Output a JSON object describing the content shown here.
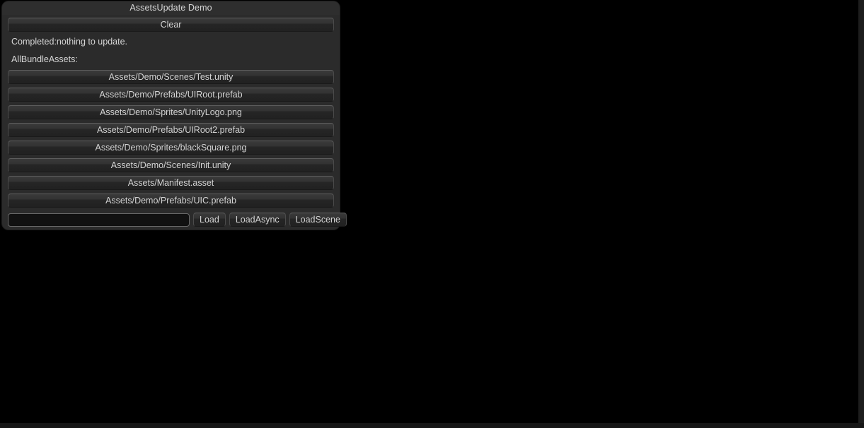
{
  "window": {
    "title": "AssetsUpdate Demo",
    "clear_label": "Clear",
    "status_message": "Completed:nothing to update.",
    "list_label": "AllBundleAssets:"
  },
  "asset_list": [
    {
      "label": "Assets/Demo/Scenes/Test.unity"
    },
    {
      "label": "Assets/Demo/Prefabs/UIRoot.prefab"
    },
    {
      "label": "Assets/Demo/Sprites/UnityLogo.png"
    },
    {
      "label": "Assets/Demo/Prefabs/UIRoot2.prefab"
    },
    {
      "label": "Assets/Demo/Sprites/blackSquare.png"
    },
    {
      "label": "Assets/Demo/Scenes/Init.unity"
    },
    {
      "label": "Assets/Manifest.asset"
    },
    {
      "label": "Assets/Demo/Prefabs/UIC.prefab"
    }
  ],
  "action_bar": {
    "input_value": "",
    "input_placeholder": "",
    "load_label": "Load",
    "load_async_label": "LoadAsync",
    "load_scene_label": "LoadScene"
  },
  "colors": {
    "background": "#000000",
    "panel": "#2b2b2b",
    "title_bar": "#2e2e2e",
    "text": "#d6d6d6",
    "button_top": "#3a3a3a",
    "button_bottom": "#212121",
    "input_background": "#111111",
    "input_border": "#6a6a6a",
    "edge_strip": "#1d1d1d"
  }
}
